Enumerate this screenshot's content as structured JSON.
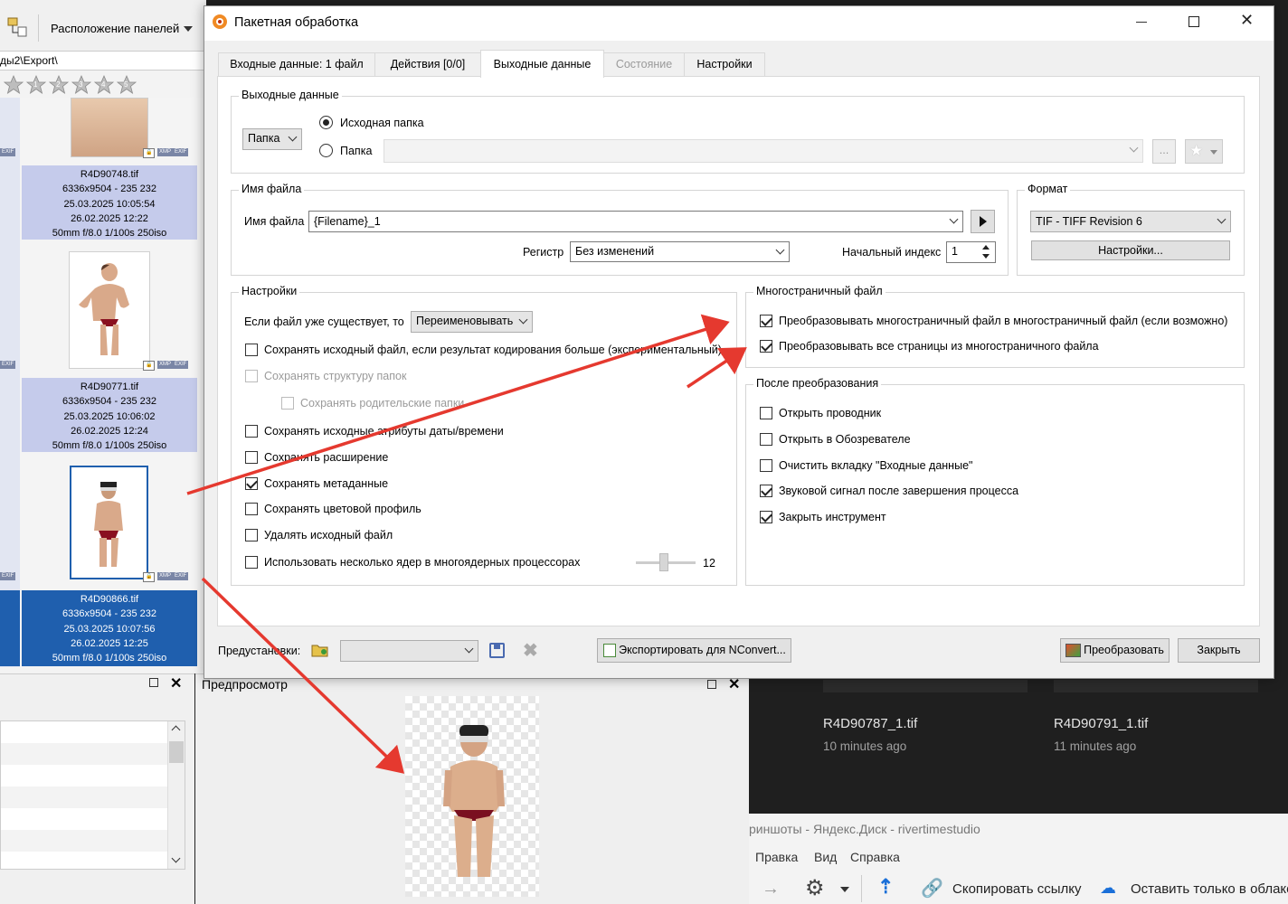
{
  "bg_app": {
    "toolbar_layout": "Расположение панелей",
    "path": "ды2\\Export\\",
    "rating_numbers": [
      "1",
      "2",
      "3",
      "4",
      "5"
    ],
    "thumbs": [
      {
        "name": "R4D90748.tif",
        "dims": "6336x9504 - 235 232",
        "date1": "25.03.2025 10:05:54",
        "date2": "26.02.2025 12:22",
        "exif": "50mm f/8.0 1/100s 250iso"
      },
      {
        "name": "R4D90771.tif",
        "dims": "6336x9504 - 235 232",
        "date1": "25.03.2025 10:06:02",
        "date2": "26.02.2025 12:24",
        "exif": "50mm f/8.0 1/100s 250iso"
      },
      {
        "name": "R4D90866.tif",
        "dims": "6336x9504 - 235 232",
        "date1": "25.03.2025 10:07:56",
        "date2": "26.02.2025 12:25",
        "exif": "50mm f/8.0 1/100s 250iso"
      }
    ],
    "badges": {
      "xmp": "XMP",
      "exif": "EXIF"
    },
    "preview_title": "Предпросмотр"
  },
  "bg_disk": {
    "files": [
      {
        "name": "R4D90787_1.tif",
        "time": "10 minutes ago"
      },
      {
        "name": "R4D90791_1.tif",
        "time": "11 minutes ago"
      }
    ],
    "title": "риншоты - Яндекс.Диск - rivertimestudio",
    "menu": [
      "Правка",
      "Вид",
      "Справка"
    ],
    "copy_link": "Скопировать ссылку",
    "leave_cloud": "Оставить только в облаке"
  },
  "dialog": {
    "title": "Пакетная обработка",
    "tabs": [
      "Входные данные: 1 файл",
      "Действия [0/0]",
      "Выходные данные",
      "Состояние",
      "Настройки"
    ],
    "active_tab": 2,
    "output": {
      "group_title": "Выходные данные",
      "type_select": "Папка",
      "radio_source": "Исходная папка",
      "radio_folder": "Папка",
      "folder_value": "",
      "browse": "..."
    },
    "filename": {
      "group_title": "Имя файла",
      "label": "Имя файла",
      "value": "{Filename}_1",
      "case_label": "Регистр",
      "case_value": "Без изменений",
      "start_index_label": "Начальный индекс",
      "start_index_value": "1"
    },
    "format": {
      "group_title": "Формат",
      "value": "TIF - TIFF Revision 6",
      "settings_btn": "Настройки..."
    },
    "settings": {
      "group_title": "Настройки",
      "exists_label": "Если файл уже существует, то",
      "exists_value": "Переименовывать",
      "options": [
        {
          "label": "Сохранять исходный файл, если результат кодирования больше (экспериментальный)",
          "checked": false,
          "disabled": false
        },
        {
          "label": "Сохранять структуру папок",
          "checked": false,
          "disabled": true
        },
        {
          "label": "Сохранять родительские папки",
          "checked": false,
          "disabled": true
        },
        {
          "label": "Сохранять исходные атрибуты даты/времени",
          "checked": false,
          "disabled": false
        },
        {
          "label": "Сохранять расширение",
          "checked": false,
          "disabled": false
        },
        {
          "label": "Сохранять метаданные",
          "checked": true,
          "disabled": false
        },
        {
          "label": "Сохранять цветовой профиль",
          "checked": false,
          "disabled": false
        },
        {
          "label": "Удалять исходный файл",
          "checked": false,
          "disabled": false
        },
        {
          "label": "Использовать несколько ядер в многоядерных процессорах",
          "checked": false,
          "disabled": false
        }
      ],
      "cores_value": "12"
    },
    "multipage": {
      "group_title": "Многостраничный файл",
      "options": [
        {
          "label": "Преобразовывать многостраничный файл в многостраничный файл (если возможно)",
          "checked": true
        },
        {
          "label": "Преобразовывать все страницы из многостраничного файла",
          "checked": true
        }
      ]
    },
    "after": {
      "group_title": "После преобразования",
      "options": [
        {
          "label": "Открыть проводник",
          "checked": false
        },
        {
          "label": "Открыть в Обозревателе",
          "checked": false
        },
        {
          "label": "Очистить вкладку \"Входные данные\"",
          "checked": false
        },
        {
          "label": "Звуковой сигнал после завершения процесса",
          "checked": true
        },
        {
          "label": "Закрыть инструмент",
          "checked": true
        }
      ]
    },
    "footer": {
      "presets_label": "Предустановки:",
      "export_btn": "Экспортировать для NConvert...",
      "convert_btn": "Преобразовать",
      "close_btn": "Закрыть"
    }
  },
  "colors": {
    "arrow": "#e5392f",
    "selected": "#1f5fae",
    "light_selected": "#c5cbeb"
  }
}
